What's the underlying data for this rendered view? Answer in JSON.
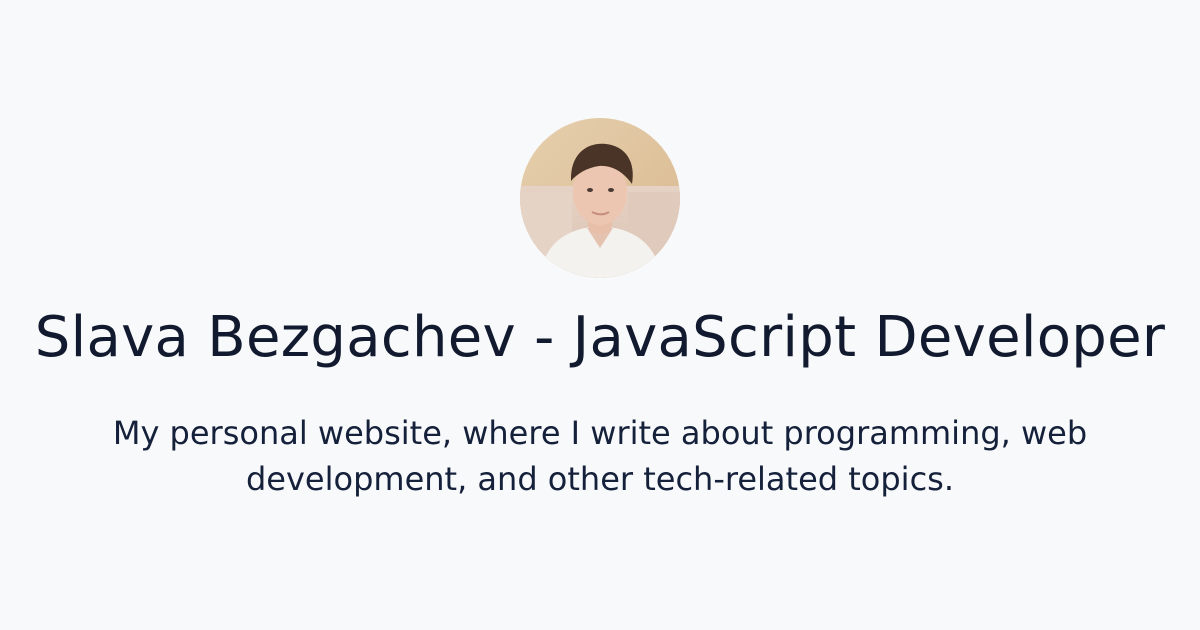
{
  "colors": {
    "background": "#f8f9fb",
    "text": "#111a2e"
  },
  "profile": {
    "avatar_icon": "profile-photo",
    "title": "Slava Bezgachev - JavaScript Developer",
    "description": "My personal website, where I write about programming, web development, and other tech-related topics."
  }
}
